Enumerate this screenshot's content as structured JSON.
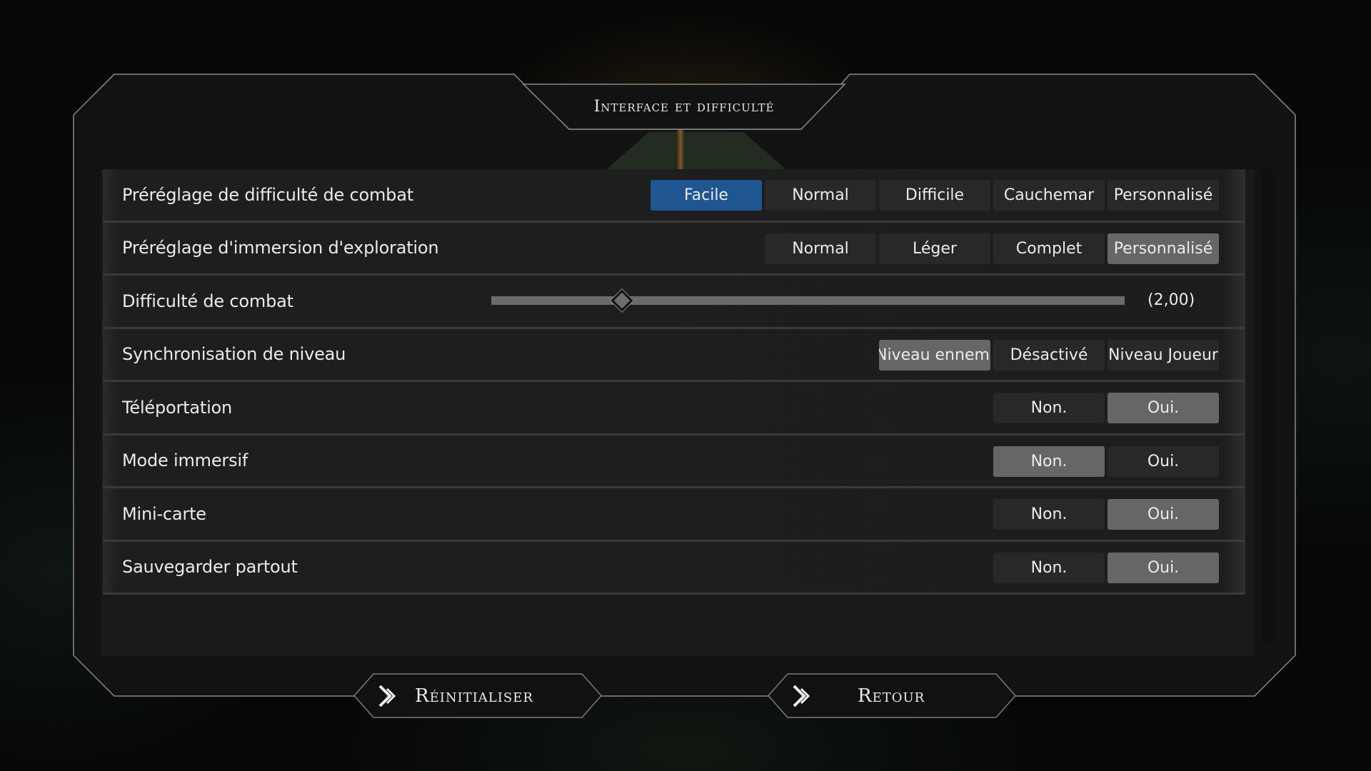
{
  "header": {
    "title": "Interface et difficulté"
  },
  "colors": {
    "accent": "#1f5691",
    "selected": "#666666",
    "option_bg": "#282828"
  },
  "settings": [
    {
      "label": "Préréglage de difficulté de combat",
      "type": "options",
      "options": [
        "Facile",
        "Normal",
        "Difficile",
        "Cauchemar",
        "Personnalisé"
      ],
      "selected": "Facile",
      "highlight": "blue"
    },
    {
      "label": "Préréglage d'immersion d'exploration",
      "type": "options",
      "options": [
        "Normal",
        "Léger",
        "Complet",
        "Personnalisé"
      ],
      "selected": "Personnalisé"
    },
    {
      "label": "Difficulté de combat",
      "type": "slider",
      "value_text": "(2,00)",
      "fraction": 0.206
    },
    {
      "label": "Synchronisation de niveau",
      "type": "options",
      "options": [
        "Niveau ennemi",
        "Désactivé",
        "Niveau Joueur"
      ],
      "selected": "Niveau ennemi"
    },
    {
      "label": "Téléportation",
      "type": "options",
      "options": [
        "Non.",
        "Oui."
      ],
      "selected": "Oui."
    },
    {
      "label": "Mode immersif",
      "type": "options",
      "options": [
        "Non.",
        "Oui."
      ],
      "selected": "Non."
    },
    {
      "label": "Mini-carte",
      "type": "options",
      "options": [
        "Non.",
        "Oui."
      ],
      "selected": "Oui."
    },
    {
      "label": "Sauvegarder partout",
      "type": "options",
      "options": [
        "Non.",
        "Oui."
      ],
      "selected": "Oui."
    }
  ],
  "footer": {
    "reset_label": "Réinitialiser",
    "back_label": "Retour",
    "reset_icon": "double-chevron-right-icon",
    "back_icon": "double-chevron-right-icon"
  }
}
